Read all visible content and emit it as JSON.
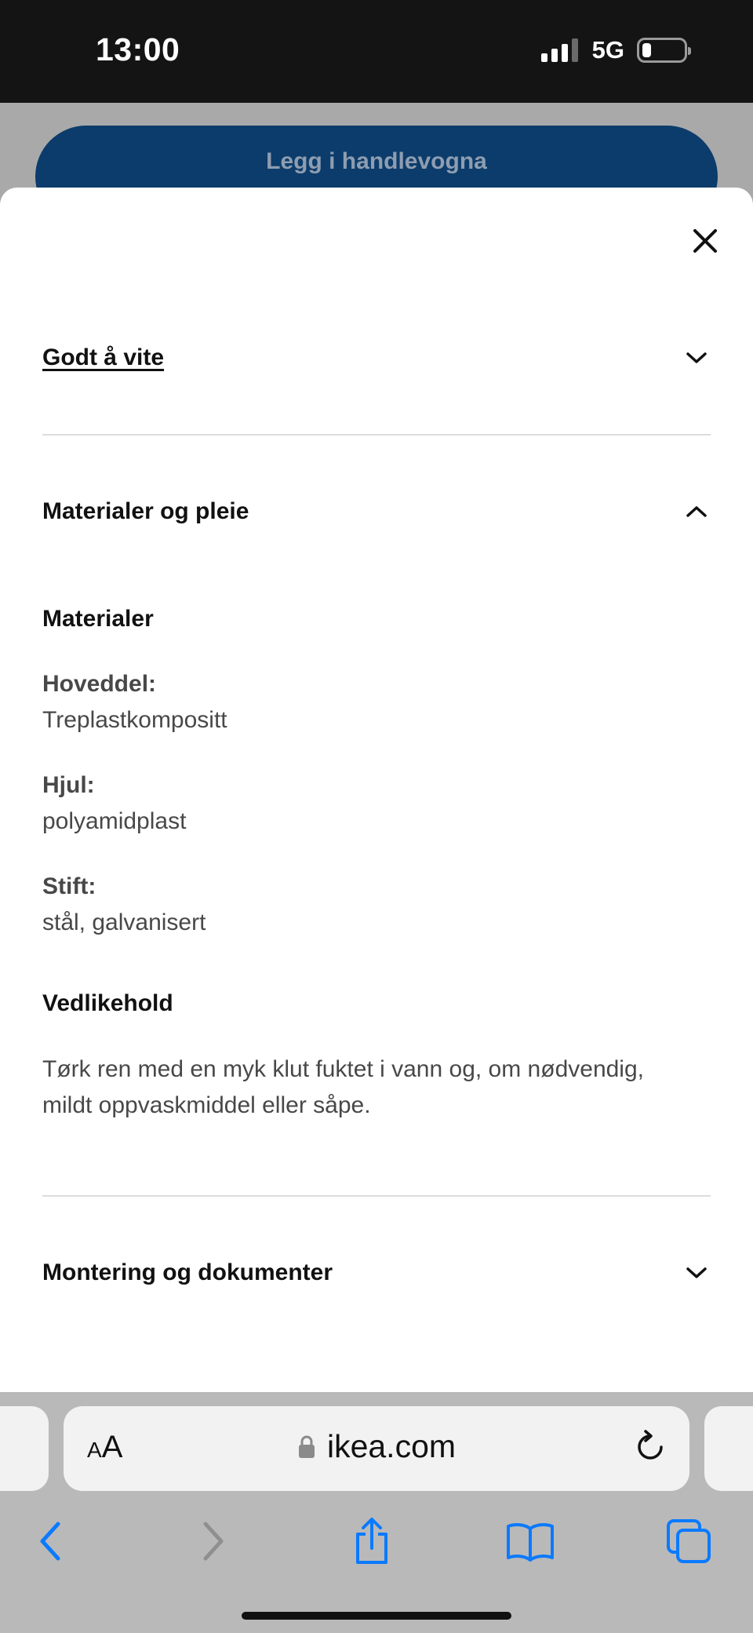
{
  "status_bar": {
    "time": "13:00",
    "network": "5G"
  },
  "background": {
    "cart_button_label": "Legg i handlevogna"
  },
  "sheet": {
    "sections": [
      {
        "title": "Godt å vite",
        "expanded": false
      },
      {
        "title": "Materialer og pleie",
        "expanded": true
      },
      {
        "title": "Montering og dokumenter",
        "expanded": false
      }
    ],
    "materials": {
      "heading": "Materialer",
      "items": [
        {
          "label": "Hoveddel:",
          "value": "Treplastkompositt"
        },
        {
          "label": "Hjul:",
          "value": "polyamidplast"
        },
        {
          "label": "Stift:",
          "value": "stål, galvanisert"
        }
      ]
    },
    "care": {
      "heading": "Vedlikehold",
      "line1": "Tørk ren med en myk klut fuktet i vann og, om nødvendig,",
      "line2": "mildt oppvaskmiddel eller såpe."
    }
  },
  "browser": {
    "text_size_label": "AA",
    "url": "ikea.com"
  },
  "colors": {
    "accent_blue": "#0a7aff",
    "cart_button": "#0b3c6b",
    "sheet_bg": "#ffffff",
    "overlay_bg": "#a9a9a9"
  },
  "icons": [
    "close-icon",
    "chevron-down-icon",
    "chevron-up-icon",
    "lock-icon",
    "reload-icon",
    "back-icon",
    "forward-icon",
    "share-icon",
    "bookmarks-icon",
    "tabs-icon"
  ]
}
